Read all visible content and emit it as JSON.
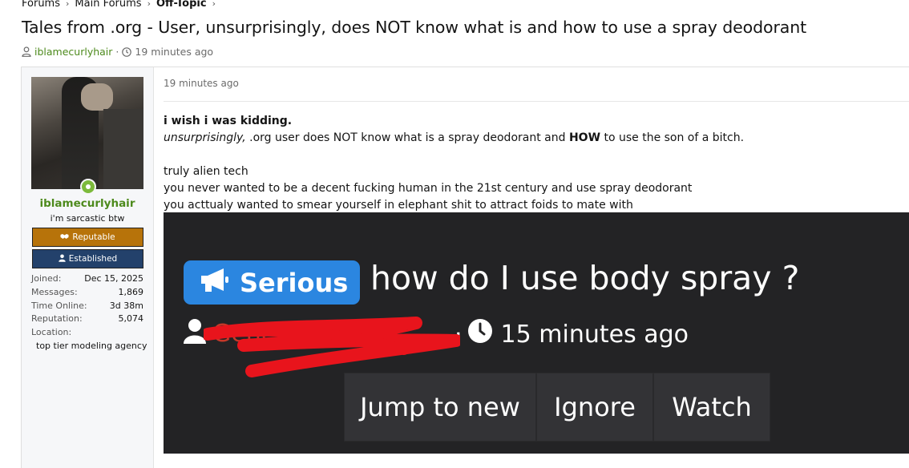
{
  "breadcrumb": {
    "items": [
      "Forums",
      "Main Forums",
      "Off-Topic"
    ]
  },
  "thread": {
    "title": "Tales from .org - User, unsurprisingly, does NOT know what is and how to use a spray deodorant",
    "author": "iblamecurlyhair",
    "age": "19 minutes ago"
  },
  "author_panel": {
    "username": "iblamecurlyhair",
    "user_title": "i'm sarcastic btw",
    "banners": [
      "Reputable",
      "Established"
    ],
    "stats": [
      {
        "label": "Joined:",
        "value": "Dec 15, 2025"
      },
      {
        "label": "Messages:",
        "value": "1,869"
      },
      {
        "label": "Time Online:",
        "value": "3d 38m"
      },
      {
        "label": "Reputation:",
        "value": "5,074"
      },
      {
        "label": "Location:",
        "value": ""
      }
    ],
    "location": "top tier modeling agency",
    "status_color": "#7cba3b"
  },
  "post": {
    "time": "19 minutes ago",
    "lines": {
      "l1": "i wish i was kidding.",
      "l2_em": "unsurprisingly,",
      "l2_mid": " .org user does NOT know what is a spray deodorant and ",
      "l2_strong": "HOW",
      "l2_end": " to use the son of a bitch.",
      "l3": "truly alien tech",
      "l4": "you never wanted to be a decent fucking human in the 21st century and use spray deodorant",
      "l5": "you acttualy wanted to smear yourself in elephant shit to attract foids to mate with"
    }
  },
  "embed": {
    "prefix": "Serious",
    "heading": "how do I use body spray ?",
    "author_redacted": "Gene",
    "age": "15 minutes ago",
    "buttons": [
      "Jump to new",
      "Ignore",
      "Watch"
    ],
    "colors": {
      "background": "#232325",
      "prefix_badge": "#2b86e0",
      "redaction": "#e8141c"
    }
  }
}
